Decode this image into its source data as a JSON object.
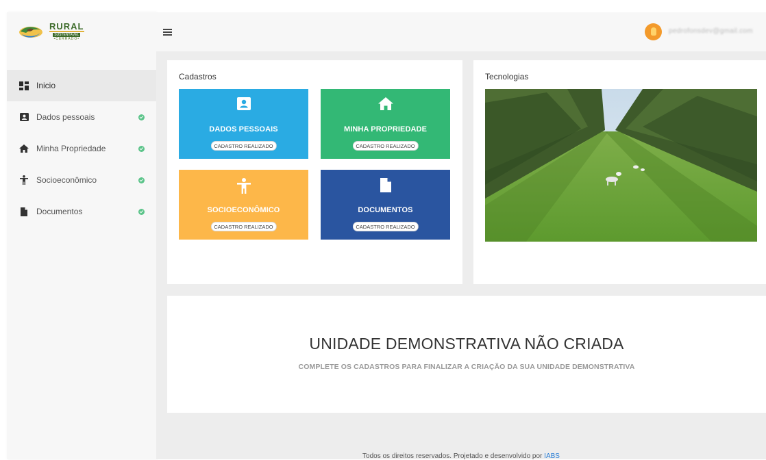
{
  "brand": {
    "name": "RURAL",
    "subtitle": "SUSTENTÁVEL",
    "region": "•CERRADO•"
  },
  "sidebar": {
    "items": [
      {
        "label": "Inicio",
        "icon": "dashboard-icon",
        "active": true,
        "completed": false
      },
      {
        "label": "Dados pessoais",
        "icon": "id-card-icon",
        "active": false,
        "completed": true
      },
      {
        "label": "Minha Propriedade",
        "icon": "home-icon",
        "active": false,
        "completed": true
      },
      {
        "label": "Socioeconômico",
        "icon": "person-icon",
        "active": false,
        "completed": true
      },
      {
        "label": "Documentos",
        "icon": "document-icon",
        "active": false,
        "completed": true
      }
    ]
  },
  "header": {
    "menu_icon": "hamburger-icon",
    "user_email": "pedrofonsdev@gmail.com"
  },
  "cadastros": {
    "title": "Cadastros",
    "tiles": [
      {
        "title": "DADOS PESSOAIS",
        "badge": "CADASTRO REALIZADO",
        "icon": "id-card-icon",
        "color": "#2aabe3"
      },
      {
        "title": "MINHA PROPRIEDADE",
        "badge": "CADASTRO REALIZADO",
        "icon": "home-icon",
        "color": "#33b875"
      },
      {
        "title": "SOCIOECONÔMICO",
        "badge": "CADASTRO REALIZADO",
        "icon": "person-icon",
        "color": "#fdb749"
      },
      {
        "title": "DOCUMENTOS",
        "badge": "CADASTRO REALIZADO",
        "icon": "document-icon",
        "color": "#2a55a0"
      }
    ]
  },
  "tecnologias": {
    "title": "Tecnologias"
  },
  "demo": {
    "title": "UNIDADE DEMONSTRATIVA NÃO CRIADA",
    "subtitle": "COMPLETE OS CADASTROS PARA FINALIZAR A CRIAÇÃO DA SUA UNIDADE DEMONSTRATIVA"
  },
  "footer": {
    "text": "Todos os direitos reservados. Projetado e desenvolvido por ",
    "link": "IABS"
  },
  "colors": {
    "check": "#5cc48a",
    "link": "#2a7fd6",
    "avatar": "#f39a2b"
  }
}
